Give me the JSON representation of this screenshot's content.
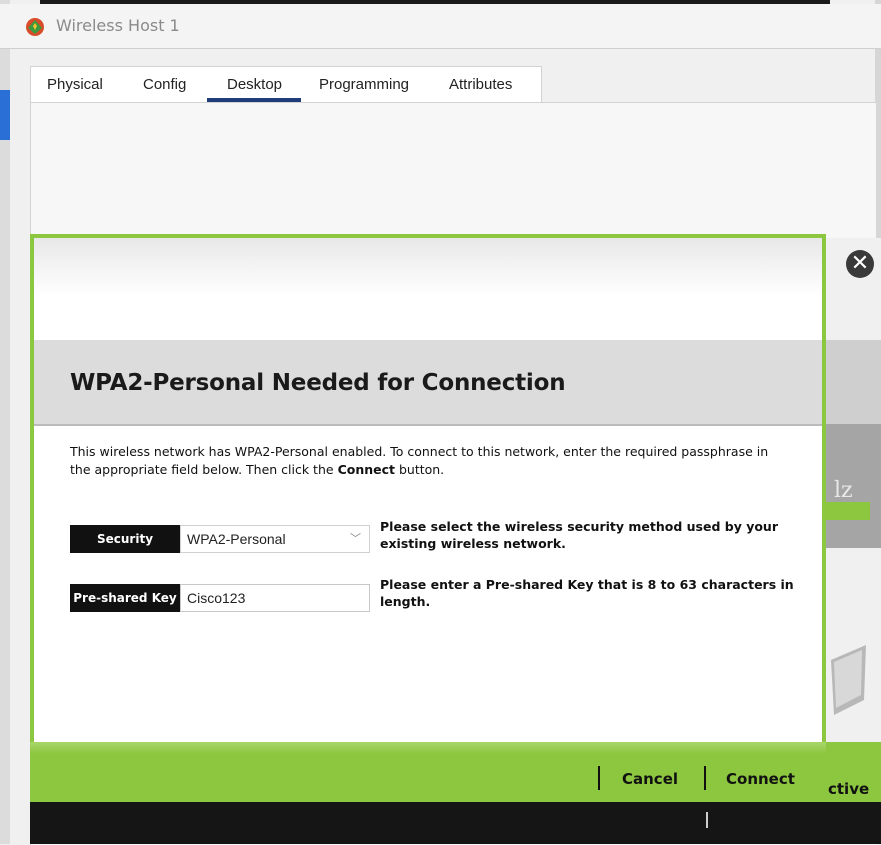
{
  "window": {
    "title": "Wireless Host 1",
    "app_icon": "packet-tracer-icon"
  },
  "tabs": [
    {
      "label": "Physical"
    },
    {
      "label": "Config"
    },
    {
      "label": "Desktop",
      "active": true
    },
    {
      "label": "Programming"
    },
    {
      "label": "Attributes"
    }
  ],
  "dialog": {
    "title": "WPA2-Personal Needed for Connection",
    "intro_part1": "This wireless network has WPA2-Personal enabled. To connect to this network, enter the required passphrase in the appropriate field below. Then click the ",
    "intro_bold": "Connect",
    "intro_part2": " button.",
    "security_label": "Security",
    "security_value": "WPA2-Personal",
    "security_help": "Please select the wireless security method used by your existing wireless network.",
    "psk_label": "Pre-shared Key",
    "psk_value": "Cisco123",
    "psk_help": "Please enter a Pre-shared Key that is 8 to 63 characters in length.",
    "cancel_label": "Cancel",
    "connect_label": "Connect"
  },
  "background": {
    "partial_text": "lz",
    "partial_button": "ctive"
  },
  "colors": {
    "accent_green": "#8dc63f",
    "tab_underline": "#1f3d7a"
  }
}
